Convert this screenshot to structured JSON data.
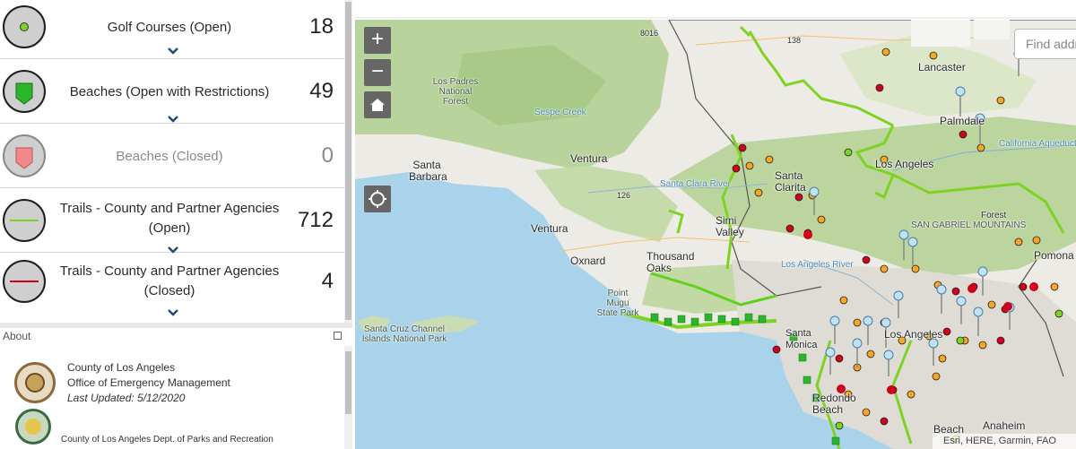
{
  "layers": [
    {
      "label": "Golf Courses (Open)",
      "count": "18"
    },
    {
      "label": "Beaches (Open with Restrictions)",
      "count": "49"
    },
    {
      "label": "Beaches (Closed)",
      "count": "0"
    },
    {
      "label": "Trails - County and Partner Agencies (Open)",
      "count": "712"
    },
    {
      "label": "Trails - County and Partner Agencies (Closed)",
      "count": "4"
    }
  ],
  "about": {
    "header": "About",
    "org_line1": "County of Los Angeles",
    "org_line2": "Office of Emergency Management",
    "updated": "Last Updated: 5/12/2020",
    "parks": "County of Los Angeles Dept. of Parks and Recreation"
  },
  "map": {
    "zoom_in": "+",
    "zoom_out": "−",
    "search_placeholder": "Find addr",
    "attribution": "Esri, HERE, Garmin, FAO",
    "labels": {
      "lancaster": "Lancaster",
      "palmdale": "Palmdale",
      "santa_barbara": "Santa Barbara",
      "ventura_county": "Ventura",
      "ventura": "Ventura",
      "oxnard": "Oxnard",
      "thousand_oaks": "Thousand Oaks",
      "santa_clarita": "Santa Clarita",
      "simi_valley": "Simi Valley",
      "los_angeles": "Los Angeles",
      "la_short": "Los Angeles",
      "pomona": "Pomona",
      "anaheim": "Anaheim",
      "redondo_beach": "Redondo Beach",
      "long_beach": "Beach",
      "santa_monica": "Santa Monica",
      "forest": "Forest",
      "sgm": "SAN GABRIEL MOUNTAINS",
      "los_padres": "Los Padres National Forest",
      "point_mugu": "Point Mugu State Park",
      "channel_islands": "Santa Cruz Channel Islands National Park",
      "sespe": "Sespe Creek",
      "santa_clara": "Santa Clara River",
      "la_river": "Los Angeles River",
      "aqueduct": "California Aqueduct",
      "r138": "138",
      "r126": "126",
      "r8016": "8016"
    }
  },
  "colors": {
    "open_trail": "#7ed321",
    "closed_trail": "#d0021b",
    "golf": "#7ed321",
    "beach_open": "#2bb52b",
    "beach_closed": "#f08a8a",
    "ocean": "#a9d3ea",
    "map_btn": "#666666"
  }
}
